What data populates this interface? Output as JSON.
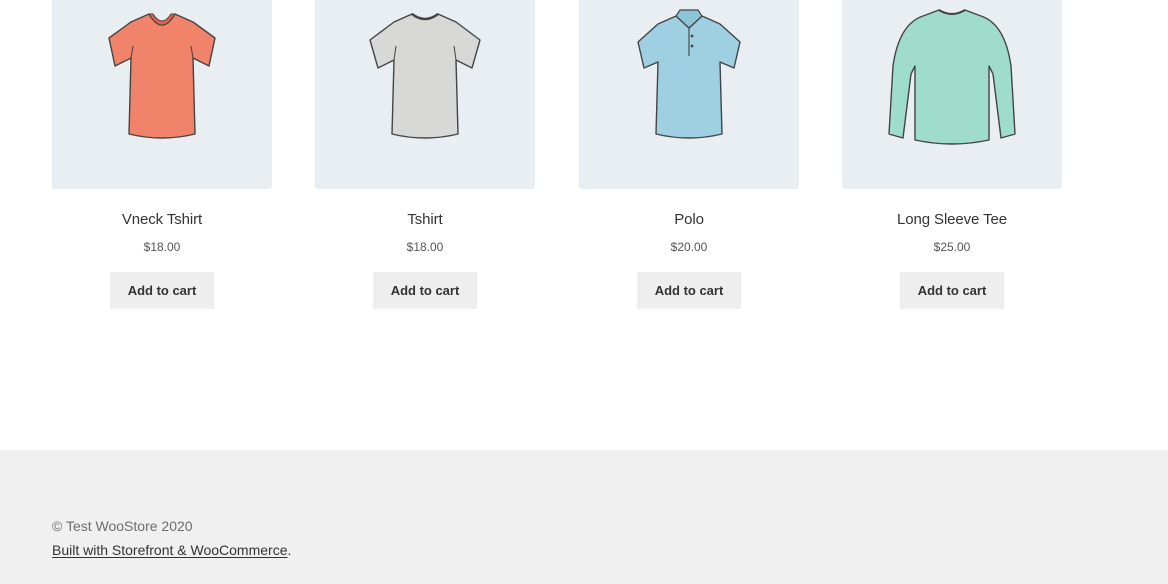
{
  "products": [
    {
      "title": "Vneck Tshirt",
      "price": "$18.00",
      "button_label": "Add to cart",
      "icon": "vneck-shirt-icon",
      "color": "#f2836b"
    },
    {
      "title": "Tshirt",
      "price": "$18.00",
      "button_label": "Add to cart",
      "icon": "tshirt-icon",
      "color": "#d8d8d6"
    },
    {
      "title": "Polo",
      "price": "$20.00",
      "button_label": "Add to cart",
      "icon": "polo-shirt-icon",
      "color": "#9fd0e2"
    },
    {
      "title": "Long Sleeve Tee",
      "price": "$25.00",
      "button_label": "Add to cart",
      "icon": "long-sleeve-tee-icon",
      "color": "#9fdcc9"
    }
  ],
  "footer": {
    "copyright": "© Test WooStore 2020",
    "credit_link": "Built with Storefront & WooCommerce",
    "credit_suffix": "."
  },
  "colors": {
    "image_background": "#e9eef3",
    "button_background": "#eeeeee",
    "footer_background": "#f0f0f0"
  }
}
